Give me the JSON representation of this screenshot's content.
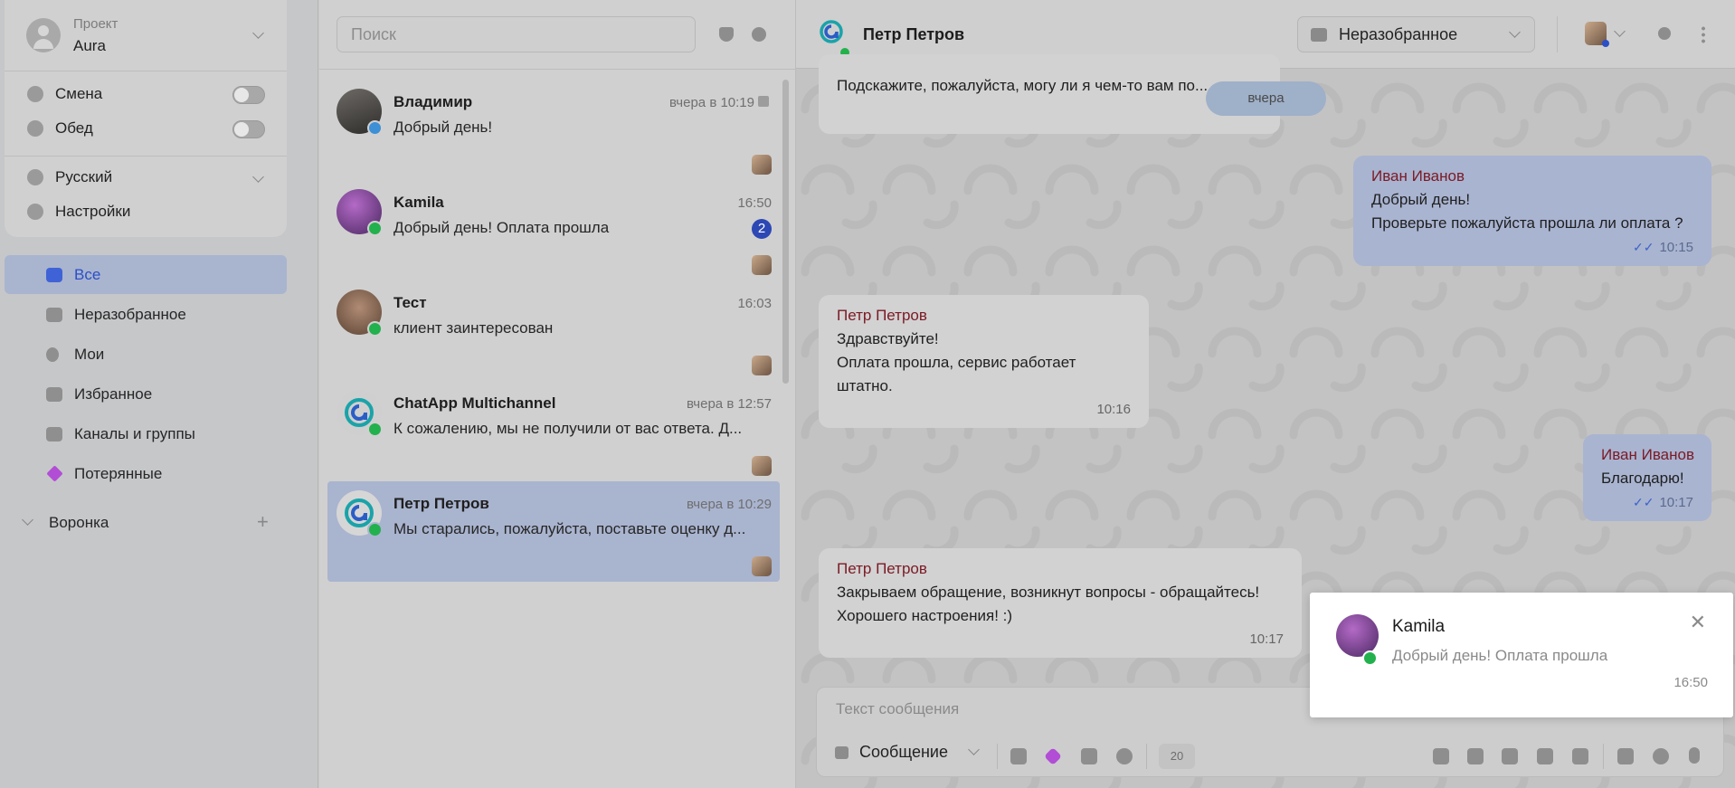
{
  "project": {
    "label": "Проект",
    "name": "Aura"
  },
  "toggles": [
    {
      "label": "Смена"
    },
    {
      "label": "Обед"
    }
  ],
  "language": "Русский",
  "settings": "Настройки",
  "nav": [
    {
      "label": "Все",
      "active": true
    },
    {
      "label": "Неразобранное"
    },
    {
      "label": "Мои"
    },
    {
      "label": "Избранное"
    },
    {
      "label": "Каналы и группы"
    },
    {
      "label": "Потерянные"
    }
  ],
  "funnel": "Воронка",
  "search": {
    "placeholder": "Поиск"
  },
  "chats": [
    {
      "name": "Владимир",
      "time": "вчера в 10:19",
      "preview": "Добрый день!",
      "channel": "telegram"
    },
    {
      "name": "Kamila",
      "time": "16:50",
      "preview": "Добрый день! Оплата прошла",
      "unread": "2",
      "channel": "whatsapp"
    },
    {
      "name": "Тест",
      "time": "16:03",
      "preview": "клиент заинтересован",
      "channel": "whatsapp"
    },
    {
      "name": "ChatApp Multichannel",
      "time": "вчера в 12:57",
      "preview": "К сожалению, мы не получили от вас ответа. Д...",
      "channel": "whatsapp"
    },
    {
      "name": "Петр Петров",
      "time": "вчера в 10:29",
      "preview": "Мы старались, пожалуйста, поставьте оценку д...",
      "channel": "whatsapp",
      "active": true
    }
  ],
  "header": {
    "name": "Петр Петров",
    "status": "Неразобранное"
  },
  "date_pill": "вчера",
  "messages": [
    {
      "text": "Подскажите, пожалуйста, могу ли я чем-то вам по..."
    },
    {
      "sender": "Иван Иванов",
      "lines": [
        "Добрый день!",
        "Проверьте пожалуйста прошла ли оплата ?"
      ],
      "time": "10:15"
    },
    {
      "sender": "Петр Петров",
      "lines": [
        "Здравствуйте!",
        "Оплата прошла, сервис работает штатно."
      ],
      "time": "10:16"
    },
    {
      "sender": "Иван Иванов",
      "lines": [
        "Благодарю!"
      ],
      "time": "10:17"
    },
    {
      "sender": "Петр Петров",
      "lines": [
        "Закрываем обращение, возникнут вопросы - обращайтесь!",
        "Хорошего настроения! :)"
      ],
      "time": "10:17"
    }
  ],
  "composer": {
    "placeholder": "Текст сообщения",
    "type": "Сообщение",
    "counter": "20"
  },
  "notification": {
    "name": "Kamila",
    "message": "Добрый день! Оплата прошла",
    "time": "16:50"
  },
  "colors": {
    "accent": "#2b4fc6",
    "sender": "#7b1a24",
    "whatsapp": "#23b14d",
    "telegram": "#3d8fd6"
  }
}
